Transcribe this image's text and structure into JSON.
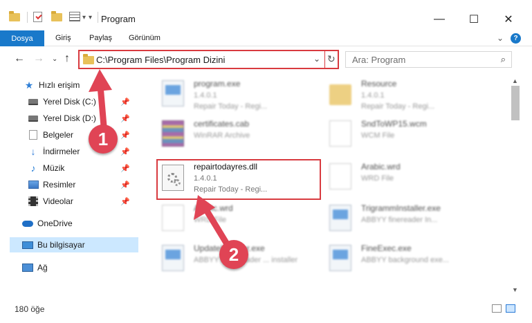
{
  "window": {
    "title": "Program",
    "minimize": "—",
    "maximize": "☐",
    "close": "✕",
    "qa_dropdown": "▾"
  },
  "ribbon": {
    "tabs": [
      "Dosya",
      "Giriş",
      "Paylaş",
      "Görünüm"
    ],
    "collapse": "⌄",
    "help": "?"
  },
  "nav": {
    "back": "←",
    "forward": "→",
    "history": "⌄",
    "up": "↑"
  },
  "address": {
    "path": "C:\\Program Files\\Program Dizini",
    "dropdown": "⌄",
    "refresh": "↻"
  },
  "search": {
    "placeholder": "Ara: Program",
    "icon": "⌕"
  },
  "sidebar": {
    "items": [
      {
        "label": "Hızlı erişim",
        "icon": "star-icon"
      },
      {
        "label": "Yerel Disk (C:)",
        "icon": "drive-icon"
      },
      {
        "label": "Yerel Disk (D:)",
        "icon": "drive-icon"
      },
      {
        "label": "Belgeler",
        "icon": "documents-icon"
      },
      {
        "label": "İndirmeler",
        "icon": "downloads-icon"
      },
      {
        "label": "Müzik",
        "icon": "music-icon"
      },
      {
        "label": "Resimler",
        "icon": "pictures-icon"
      },
      {
        "label": "Videolar",
        "icon": "videos-icon"
      },
      {
        "label": "OneDrive",
        "icon": "cloud-icon"
      },
      {
        "label": "Bu bilgisayar",
        "icon": "computer-icon"
      },
      {
        "label": "Ağ",
        "icon": "network-icon"
      }
    ],
    "pin": "📌"
  },
  "files": [
    {
      "name": "program.exe",
      "line1": "1.4.0.1",
      "line2": "Repair Today - Regi..."
    },
    {
      "name": "Resource",
      "line1": "1.4.0.1",
      "line2": "Repair Today - Regi..."
    },
    {
      "name": "certificates.cab",
      "line1": "WinRAR Archive",
      "line2": ""
    },
    {
      "name": "SndToWP15.wcm",
      "line1": "WCM File",
      "line2": ""
    },
    {
      "name": "repairtodayres.dll",
      "line1": "1.4.0.1",
      "line2": "Repair Today - Regi..."
    },
    {
      "name": "Arabic.wrd",
      "line1": "WRD File",
      "line2": ""
    },
    {
      "name": "Arabic.wrd",
      "line1": "WRD File",
      "line2": ""
    },
    {
      "name": "TrigrammInstaller.exe",
      "line1": "ABBYY finereader In...",
      "line2": ""
    },
    {
      "name": "UpdateInstaller.exe",
      "line1": "ABBYY FineReader ... installer",
      "line2": ""
    },
    {
      "name": "FineExec.exe",
      "line1": "ABBYY background exe...",
      "line2": ""
    }
  ],
  "status": {
    "count": "180 öğe"
  },
  "annotations": [
    "1",
    "2"
  ],
  "colors": {
    "accent": "#1979ca",
    "highlight": "#d83a3f",
    "marker": "#e04455",
    "selection": "#cce8ff"
  }
}
